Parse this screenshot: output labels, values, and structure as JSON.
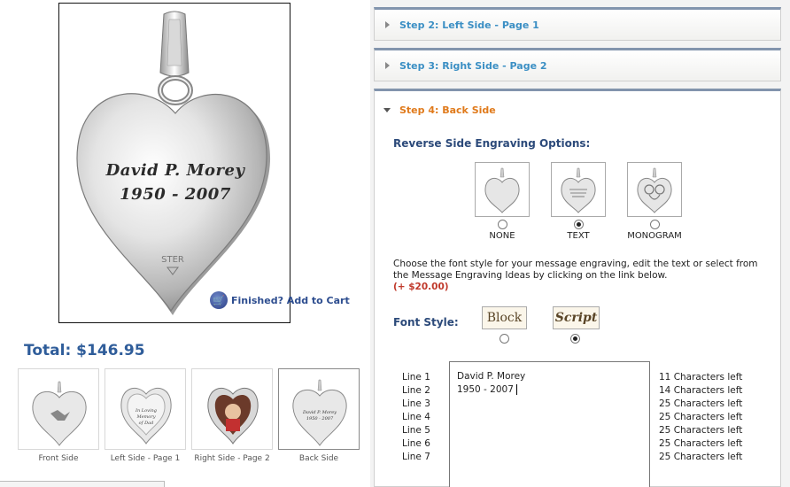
{
  "preview": {
    "engraving_line1": "David P. Morey",
    "engraving_line2": "1950 - 2007",
    "hallmark": "STER",
    "add_to_cart": "Finished? Add to Cart"
  },
  "total": {
    "label": "Total: $146.95"
  },
  "thumbnails": [
    {
      "label": "Front Side",
      "selected": false
    },
    {
      "label": "Left Side - Page 1",
      "selected": false
    },
    {
      "label": "Right Side - Page 2",
      "selected": false
    },
    {
      "label": "Back Side",
      "selected": true
    }
  ],
  "steps": {
    "step2": "Step 2: Left Side - Page 1",
    "step3": "Step 3: Right Side - Page 2",
    "step4": "Step 4: Back Side"
  },
  "reverse": {
    "title": "Reverse Side Engraving Options:",
    "options": [
      {
        "label": "NONE",
        "selected": false
      },
      {
        "label": "TEXT",
        "selected": true
      },
      {
        "label": "MONOGRAM",
        "selected": false
      }
    ]
  },
  "instructions": "Choose the font style for your message engraving, edit the text or select from the Message Engraving Ideas by clicking on the link below.",
  "price_add": "(+ $20.00)",
  "font_style": {
    "label": "Font Style:",
    "block": "Block",
    "script": "Script",
    "selected": "Script"
  },
  "lines": [
    {
      "label": "Line 1",
      "text": "David P. Morey",
      "chars_left": "11 Characters left"
    },
    {
      "label": "Line 2",
      "text": "1950 - 2007",
      "chars_left": "14 Characters left"
    },
    {
      "label": "Line 3",
      "text": "",
      "chars_left": "25 Characters left"
    },
    {
      "label": "Line 4",
      "text": "",
      "chars_left": "25 Characters left"
    },
    {
      "label": "Line 5",
      "text": "",
      "chars_left": "25 Characters left"
    },
    {
      "label": "Line 6",
      "text": "",
      "chars_left": "25 Characters left"
    },
    {
      "label": "Line 7",
      "text": "",
      "chars_left": "25 Characters left"
    }
  ],
  "colors": {
    "step_title": "#3b8fc4",
    "step_active": "#e07a1b",
    "heading": "#2c4a7a",
    "price": "#c0392b"
  }
}
